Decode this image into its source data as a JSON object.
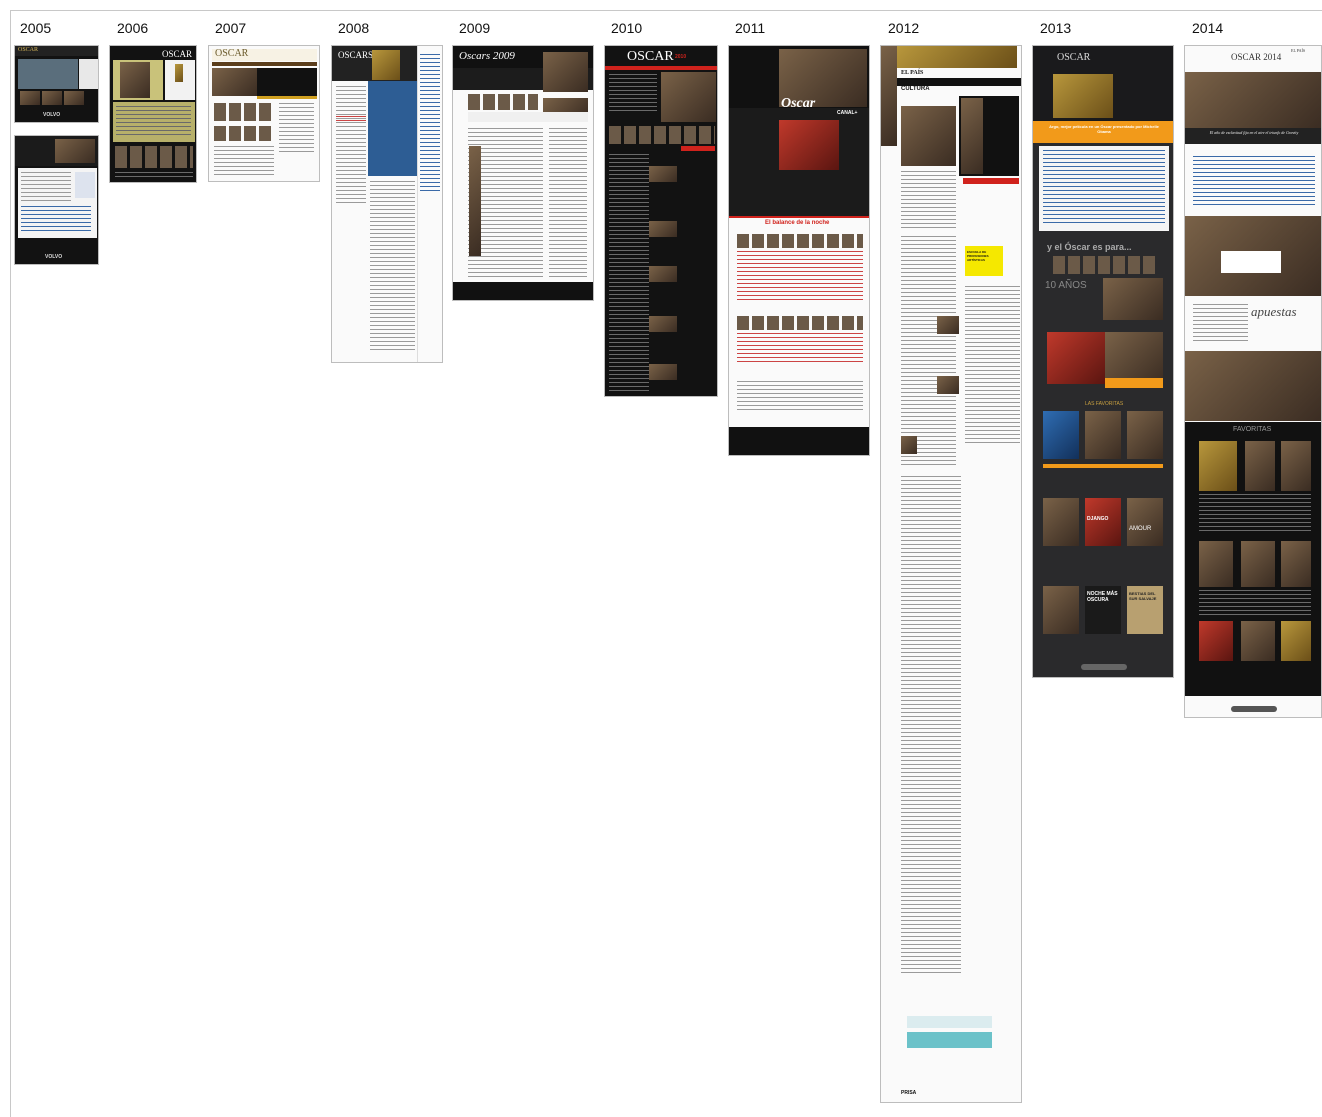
{
  "timeline": {
    "years": [
      "2005",
      "2006",
      "2007",
      "2008",
      "2009",
      "2010",
      "2011",
      "2012",
      "2013",
      "2014"
    ]
  },
  "screenshots": {
    "y2005": {
      "logo_top": "OSCAR",
      "brand": "VOLVO",
      "brand_bottom": "VOLVO"
    },
    "y2006": {
      "logo": "OSCAR"
    },
    "y2007": {
      "logo": "OSCAR"
    },
    "y2008": {
      "logo": "OSCARS"
    },
    "y2009": {
      "logo": "Oscars 2009"
    },
    "y2010": {
      "logo": "OSCAR",
      "sub": "2010"
    },
    "y2011": {
      "logo": "Oscar",
      "partner": "CANAL+",
      "headline": "El balance de la noche"
    },
    "y2012": {
      "brand": "EL PAÍS",
      "section": "CULTURA",
      "yellow_box": "ESCUELA DE PROFESIONES ARTÍSTICAS",
      "footer": "PRISA"
    },
    "y2013": {
      "logo": "OSCAR",
      "banner": "Argo, mejor película en un Óscar presentado por Michelle Obama",
      "strip": "y el Óscar es para...",
      "anos": "10 AÑOS",
      "favoritas": "LAS FAVORITAS",
      "poster1": "NOCHE MÁS OSCURA",
      "poster2": "BESTIAS DEL SUR SALVAJE",
      "poster3": "AMOUR",
      "poster4": "DJANGO"
    },
    "y2014": {
      "logo": "OSCAR 2014",
      "brand": "EL PAÍS",
      "headline": "El año de esclavitud fija en el aire el triunfo de Gravity",
      "apuestas": "apuestas",
      "favoritas": "FAVORITAS"
    }
  },
  "colors": {
    "accent_red": "#d0221c",
    "orange": "#f29a1a",
    "gold": "#b8973c",
    "dark": "#121212",
    "charcoal": "#2a2a2c"
  }
}
